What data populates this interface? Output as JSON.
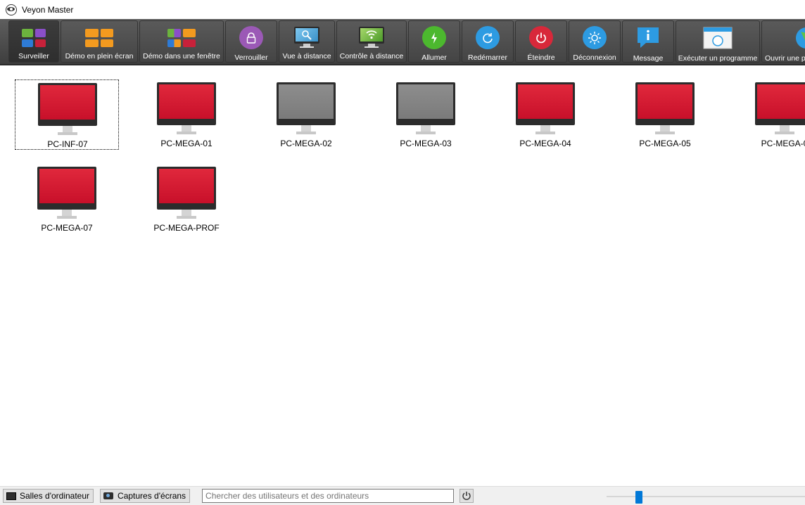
{
  "window": {
    "title": "Veyon Master",
    "icon": "veyon-eye-icon"
  },
  "toolbar": {
    "buttons": [
      {
        "label": "Surveiller",
        "icon": "monitor-grid-icon",
        "active": true
      },
      {
        "label": "Démo en plein écran",
        "icon": "fullscreen-demo-icon"
      },
      {
        "label": "Démo dans une fenêtre",
        "icon": "window-demo-icon"
      },
      {
        "label": "Verrouiller",
        "icon": "lock-icon"
      },
      {
        "label": "Vue à distance",
        "icon": "remote-view-icon"
      },
      {
        "label": "Contrôle à distance",
        "icon": "remote-control-icon"
      },
      {
        "label": "Allumer",
        "icon": "power-on-icon"
      },
      {
        "label": "Redémarrer",
        "icon": "reboot-icon"
      },
      {
        "label": "Éteindre",
        "icon": "power-off-icon"
      },
      {
        "label": "Déconnexion",
        "icon": "logout-icon"
      },
      {
        "label": "Message",
        "icon": "message-icon"
      },
      {
        "label": "Exécuter un programme",
        "icon": "run-program-icon"
      },
      {
        "label": "Ouvrir une p",
        "icon": "globe-icon"
      }
    ]
  },
  "computers": [
    {
      "name": "PC-INF-07",
      "state": "red",
      "selected": true
    },
    {
      "name": "PC-MEGA-01",
      "state": "red"
    },
    {
      "name": "PC-MEGA-02",
      "state": "grey"
    },
    {
      "name": "PC-MEGA-03",
      "state": "grey"
    },
    {
      "name": "PC-MEGA-04",
      "state": "red"
    },
    {
      "name": "PC-MEGA-05",
      "state": "red"
    },
    {
      "name": "PC-MEGA-0",
      "state": "red"
    },
    {
      "name": "PC-MEGA-07",
      "state": "red"
    },
    {
      "name": "PC-MEGA-PROF",
      "state": "red"
    }
  ],
  "statusbar": {
    "rooms_label": "Salles d'ordinateur",
    "screenshots_label": "Captures d'écrans",
    "search_placeholder": "Chercher des utilisateurs et des ordinateurs",
    "zoom_level": 0.15
  },
  "colors": {
    "screen_red": "#d41c32",
    "screen_grey": "#858585",
    "slider_accent": "#0078d7"
  }
}
